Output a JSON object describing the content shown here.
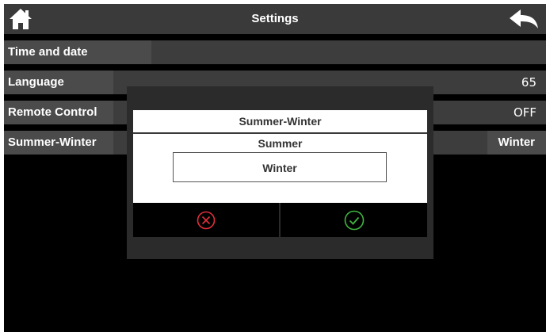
{
  "header": {
    "title": "Settings",
    "home_icon": "home-icon",
    "back_icon": "back-arrow-icon"
  },
  "settings": {
    "items": [
      {
        "label": "Time and date",
        "value": ""
      },
      {
        "label": "Language",
        "value": "65"
      },
      {
        "label": "Remote Control",
        "value": "OFF"
      },
      {
        "label": "Summer-Winter",
        "value": "Winter"
      }
    ]
  },
  "dialog": {
    "title": "Summer-Winter",
    "options": [
      "Summer",
      "Winter"
    ],
    "selected": "Winter",
    "cancel_icon": "cancel-x-icon",
    "confirm_icon": "confirm-check-icon",
    "colors": {
      "cancel": "#e0303a",
      "confirm": "#3fb63f"
    }
  }
}
